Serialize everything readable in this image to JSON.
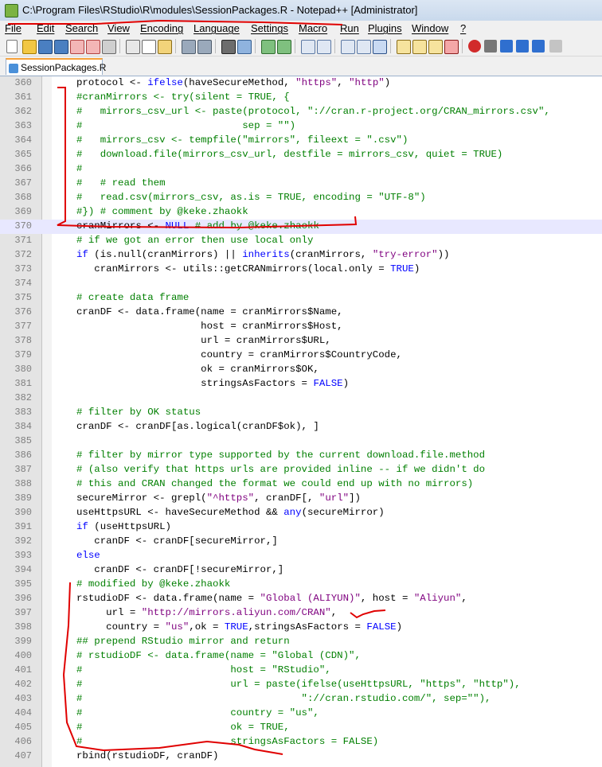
{
  "window": {
    "title": "C:\\Program Files\\RStudio\\R\\modules\\SessionPackages.R - Notepad++ [Administrator]"
  },
  "menu": [
    "File",
    "Edit",
    "Search",
    "View",
    "Encoding",
    "Language",
    "Settings",
    "Macro",
    "Run",
    "Plugins",
    "Window",
    "?"
  ],
  "tab": {
    "label": "SessionPackages.R"
  },
  "editor": {
    "current_line": 370,
    "lines": [
      {
        "n": "360",
        "t": "protocol <- ifelse(haveSecureMethod, \"https\", \"http\")"
      },
      {
        "n": "361",
        "t": "#cranMirrors <- try(silent = TRUE, {"
      },
      {
        "n": "362",
        "t": "#   mirrors_csv_url <- paste(protocol, \"://cran.r-project.org/CRAN_mirrors.csv\","
      },
      {
        "n": "363",
        "t": "#                           sep = \"\")"
      },
      {
        "n": "364",
        "t": "#   mirrors_csv <- tempfile(\"mirrors\", fileext = \".csv\")"
      },
      {
        "n": "365",
        "t": "#   download.file(mirrors_csv_url, destfile = mirrors_csv, quiet = TRUE)"
      },
      {
        "n": "366",
        "t": "#"
      },
      {
        "n": "367",
        "t": "#   # read them"
      },
      {
        "n": "368",
        "t": "#   read.csv(mirrors_csv, as.is = TRUE, encoding = \"UTF-8\")"
      },
      {
        "n": "369",
        "t": "#}) # comment by @keke.zhaokk"
      },
      {
        "n": "370",
        "t": "cranMirrors <- NULL # add by @keke.zhaokk"
      },
      {
        "n": "371",
        "t": "# if we got an error then use local only"
      },
      {
        "n": "372",
        "t": "if (is.null(cranMirrors) || inherits(cranMirrors, \"try-error\"))"
      },
      {
        "n": "373",
        "t": "   cranMirrors <- utils::getCRANmirrors(local.only = TRUE)"
      },
      {
        "n": "374",
        "t": ""
      },
      {
        "n": "375",
        "t": "# create data frame"
      },
      {
        "n": "376",
        "t": "cranDF <- data.frame(name = cranMirrors$Name,"
      },
      {
        "n": "377",
        "t": "                     host = cranMirrors$Host,"
      },
      {
        "n": "378",
        "t": "                     url = cranMirrors$URL,"
      },
      {
        "n": "379",
        "t": "                     country = cranMirrors$CountryCode,"
      },
      {
        "n": "380",
        "t": "                     ok = cranMirrors$OK,"
      },
      {
        "n": "381",
        "t": "                     stringsAsFactors = FALSE)"
      },
      {
        "n": "382",
        "t": ""
      },
      {
        "n": "383",
        "t": "# filter by OK status"
      },
      {
        "n": "384",
        "t": "cranDF <- cranDF[as.logical(cranDF$ok), ]"
      },
      {
        "n": "385",
        "t": ""
      },
      {
        "n": "386",
        "t": "# filter by mirror type supported by the current download.file.method"
      },
      {
        "n": "387",
        "t": "# (also verify that https urls are provided inline -- if we didn't do"
      },
      {
        "n": "388",
        "t": "# this and CRAN changed the format we could end up with no mirrors)"
      },
      {
        "n": "389",
        "t": "secureMirror <- grepl(\"^https\", cranDF[, \"url\"])"
      },
      {
        "n": "390",
        "t": "useHttpsURL <- haveSecureMethod && any(secureMirror)"
      },
      {
        "n": "391",
        "t": "if (useHttpsURL)"
      },
      {
        "n": "392",
        "t": "   cranDF <- cranDF[secureMirror,]"
      },
      {
        "n": "393",
        "t": "else"
      },
      {
        "n": "394",
        "t": "   cranDF <- cranDF[!secureMirror,]"
      },
      {
        "n": "395",
        "t": "# modified by @keke.zhaokk"
      },
      {
        "n": "396",
        "t": "rstudioDF <- data.frame(name = \"Global (ALIYUN)\", host = \"Aliyun\","
      },
      {
        "n": "397",
        "t": "     url = \"http://mirrors.aliyun.com/CRAN\","
      },
      {
        "n": "398",
        "t": "     country = \"us\",ok = TRUE,stringsAsFactors = FALSE)"
      },
      {
        "n": "399",
        "t": "## prepend RStudio mirror and return"
      },
      {
        "n": "400",
        "t": "# rstudioDF <- data.frame(name = \"Global (CDN)\","
      },
      {
        "n": "401",
        "t": "#                         host = \"RStudio\","
      },
      {
        "n": "402",
        "t": "#                         url = paste(ifelse(useHttpsURL, \"https\", \"http\"),"
      },
      {
        "n": "403",
        "t": "#                                     \"://cran.rstudio.com/\", sep=\"\"),"
      },
      {
        "n": "404",
        "t": "#                         country = \"us\","
      },
      {
        "n": "405",
        "t": "#                         ok = TRUE,"
      },
      {
        "n": "406",
        "t": "#                         stringsAsFactors = FALSE)"
      },
      {
        "n": "407",
        "t": "rbind(rstudioDF, cranDF)"
      }
    ]
  },
  "colors": {
    "comment": "#007f00",
    "keyword": "#0000ff",
    "string": "#7f007f",
    "annotation": "#e00000",
    "current_line_bg": "#e8e8ff"
  }
}
